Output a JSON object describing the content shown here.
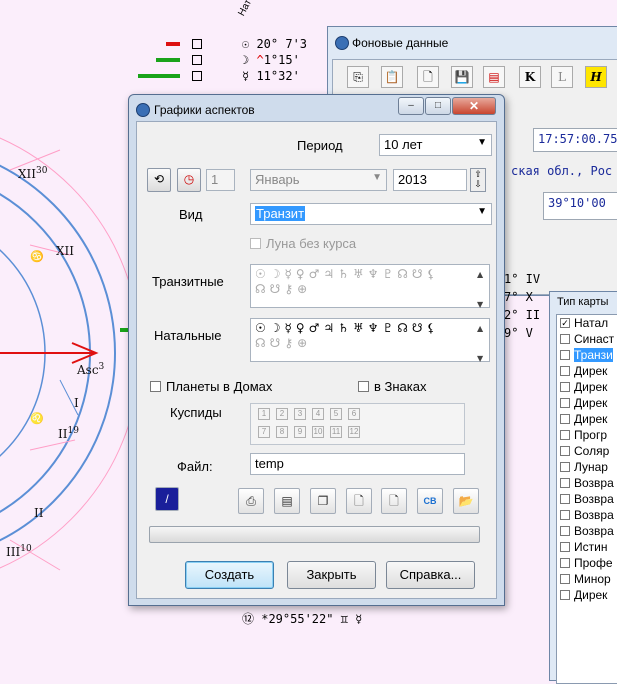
{
  "background": {
    "wheel_labels": {
      "xii30": "XII",
      "xii30_sup": "30",
      "xii": "XII",
      "asc": "Asc",
      "asc_sup": "3",
      "i": "I",
      "ii19": "II",
      "ii19_sup": "19",
      "ii": "II",
      "iii10": "III",
      "iii10_sup": "10"
    },
    "nat_header": "Нат",
    "planet_rows": [
      "20° 7'3",
      "1°15'",
      "11°32'"
    ],
    "bottom_line": "*29°55'22\"",
    "right_lines": [
      "1° IV",
      "7° X",
      "2° II",
      "9° V"
    ],
    "colors": {
      "wheel_ring": "#5b8fd6",
      "asc_arrow": "#e01010",
      "green_bar": "#1aa31a",
      "red_bar": "#dd1111"
    }
  },
  "bg_window": {
    "title": "Фоновые данные",
    "toolbar": [
      "copy-icon",
      "paste-icon",
      "new-doc-icon",
      "save-icon",
      "grid-icon",
      "K",
      "L",
      "H"
    ],
    "time_value": "17:57:00.75",
    "place_value": "ская обл., Рос",
    "coord_value": "39°10'00"
  },
  "type_panel": {
    "title": "Тип карты",
    "items": [
      {
        "label": "Натал",
        "checked": "✓",
        "selected": false
      },
      {
        "label": "Синаст",
        "checked": "",
        "selected": false
      },
      {
        "label": "Транзи",
        "checked": "",
        "selected": true
      },
      {
        "label": "Дирек",
        "checked": "",
        "selected": false
      },
      {
        "label": "Дирек",
        "checked": "",
        "selected": false
      },
      {
        "label": "Дирек",
        "checked": "",
        "selected": false
      },
      {
        "label": "Дирек",
        "checked": "",
        "selected": false
      },
      {
        "label": "Прогр",
        "checked": "",
        "selected": false
      },
      {
        "label": "Соляр",
        "checked": "",
        "selected": false
      },
      {
        "label": "Лунар",
        "checked": "",
        "selected": false
      },
      {
        "label": "Возвра",
        "checked": "",
        "selected": false
      },
      {
        "label": "Возвра",
        "checked": "",
        "selected": false
      },
      {
        "label": "Возвра",
        "checked": "",
        "selected": false
      },
      {
        "label": "Возвра",
        "checked": "",
        "selected": false
      },
      {
        "label": "Истин",
        "checked": "",
        "selected": false
      },
      {
        "label": "Профе",
        "checked": "",
        "selected": false
      },
      {
        "label": "Минор",
        "checked": "",
        "selected": false
      },
      {
        "label": "Дирек",
        "checked": "",
        "selected": false
      }
    ]
  },
  "dialog": {
    "title": "Графики аспектов",
    "caption_buttons": [
      "–",
      "□",
      "✕"
    ],
    "period_label": "Период",
    "period_value": "10 лет",
    "day_value": "1",
    "month_value": "Январь",
    "year_value": "2013",
    "view_label": "Вид",
    "view_value": "Транзит",
    "moon_void_label": "Луна без курса",
    "transit_label": "Транзитные",
    "natal_label": "Натальные",
    "transit_glyphs_line1": "☉☽☿♀♂♃♄♅♆♇☊☋⚸",
    "transit_glyphs_line2": "☊☋⚷⊕",
    "natal_glyphs_line1": "☉☽☿♀♂♃♄♅♆♇☊☋⚸",
    "natal_glyphs_line2": "☊☋⚷⊕",
    "planets_in_houses_label": "Планеты в Домах",
    "in_signs_label": "в Знаках",
    "cusps_label": "Куспиды",
    "cusps": [
      "1",
      "2",
      "3",
      "4",
      "5",
      "6",
      "7",
      "8",
      "9",
      "10",
      "11",
      "12"
    ],
    "file_label": "Файл:",
    "file_value": "temp",
    "tools": [
      "printer-icon",
      "print-preview-icon",
      "copy-pages-icon",
      "page-icon",
      "page-blank-icon",
      "cb-icon",
      "open-folder-icon"
    ],
    "create_label": "Создать",
    "close_label": "Закрыть",
    "help_label": "Справка..."
  }
}
